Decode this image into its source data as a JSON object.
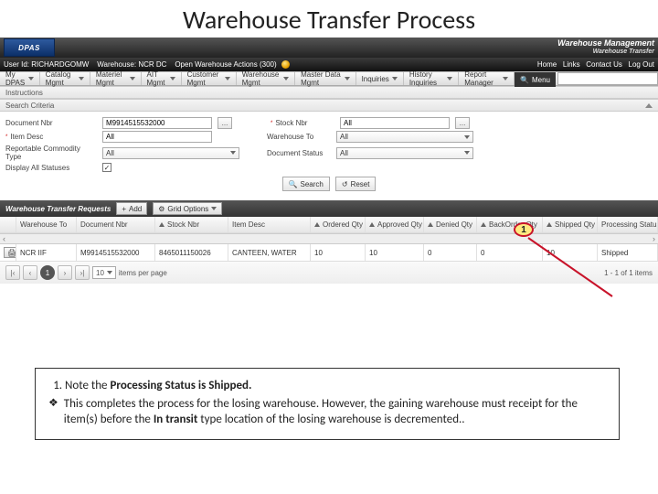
{
  "slide": {
    "title": "Warehouse Transfer Process"
  },
  "branding": {
    "logo_text": "DPAS",
    "wm_title": "Warehouse Management",
    "wm_sub": "Warehouse Transfer"
  },
  "user_strip": {
    "user_label": "User Id:",
    "user_value": "RICHARDGOMW",
    "wh_label": "Warehouse:",
    "wh_value": "NCR DC",
    "open_actions": "Open Warehouse Actions (300)",
    "links": [
      "Home",
      "Links",
      "Contact Us",
      "Log Out"
    ]
  },
  "nav": {
    "items": [
      "My DPAS",
      "Catalog Mgmt",
      "Materiel Mgmt",
      "AIT Mgmt",
      "Customer Mgmt",
      "Warehouse Mgmt",
      "Master Data Mgmt",
      "Inquiries",
      "History Inquiries",
      "Report Manager"
    ],
    "menu_btn": "Menu",
    "search_placeholder": ""
  },
  "sections": {
    "instructions": "Instructions",
    "criteria": "Search Criteria"
  },
  "criteria": {
    "doc_nbr_label": "Document Nbr",
    "doc_nbr_value": "M9914515532000",
    "stock_nbr_label": "Stock Nbr",
    "stock_nbr_value": "All",
    "item_desc_label": "Item Desc",
    "item_desc_value": "All",
    "warehouse_to_label": "Warehouse To",
    "warehouse_to_value": "All",
    "rep_type_label": "Reportable Commodity Type",
    "rep_type_value": "All",
    "doc_status_label": "Document Status",
    "doc_status_value": "All",
    "display_all_label": "Display All Statuses",
    "display_all_checked": "✓",
    "required_marker": "*",
    "ellipsis": "...",
    "search_btn": "Search",
    "reset_btn": "Reset"
  },
  "grid": {
    "title": "Warehouse Transfer Requests",
    "add_btn": "Add",
    "plus": "+",
    "grid_options_btn": "Grid Options",
    "headers": {
      "warehouse_to": "Warehouse To",
      "document_nbr": "Document Nbr",
      "stock_nbr": "Stock Nbr",
      "item_desc": "Item Desc",
      "ordered_qty": "Ordered Qty",
      "approved_qty": "Approved Qty",
      "denied_qty": "Denied Qty",
      "backorder_qty": "BackOrder Qty",
      "shipped_qty": "Shipped Qty",
      "processing_status": "Processing Status"
    },
    "sort_indicator": "▲",
    "row": {
      "print_btn": "Print - 348",
      "warehouse_to": "NCR IIF",
      "document_nbr": "M9914515532000",
      "stock_nbr": "8465011150026",
      "item_desc": "CANTEEN, WATER",
      "ordered_qty": "10",
      "approved_qty": "10",
      "denied_qty": "0",
      "backorder_qty": "0",
      "shipped_qty": "10",
      "processing_status": "Shipped"
    }
  },
  "pager": {
    "first": "|‹",
    "prev": "‹",
    "current": "1",
    "next": "›",
    "last": "›|",
    "per_page_value": "10",
    "per_page_label": "items per page",
    "count_text": "1 - 1 of 1 items"
  },
  "callout": {
    "num": "1"
  },
  "notes": {
    "n1_pre": "Note the ",
    "n1_bold": "Processing Status is Shipped.",
    "b_pre": "This completes the process for the losing warehouse.  However, the gaining warehouse must receipt for the item(s) before the ",
    "b_bold": "In transit",
    "b_post": " type location of the losing warehouse is decremented.."
  }
}
